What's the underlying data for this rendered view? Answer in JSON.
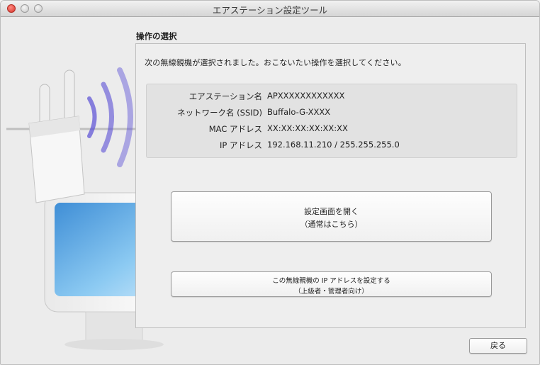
{
  "window": {
    "title": "エアステーション設定ツール"
  },
  "section": {
    "title": "操作の選択"
  },
  "instruction": "次の無線親機が選択されました。おこないたい操作を選択してください。",
  "device_info": [
    {
      "label": "エアステーション名",
      "value": "APXXXXXXXXXXXX"
    },
    {
      "label": "ネットワーク名 (SSID)",
      "value": "Buffalo-G-XXXX"
    },
    {
      "label": "MAC アドレス",
      "value": "XX:XX:XX:XX:XX:XX"
    },
    {
      "label": "IP アドレス",
      "value": "192.168.11.210 / 255.255.255.0"
    }
  ],
  "buttons": {
    "open_settings": {
      "line1": "設定画面を開く",
      "line2": "（通常はこちら）"
    },
    "set_ip": {
      "line1": "この無線親機の IP アドレスを設定する",
      "line2": "（上級者・管理者向け）"
    },
    "back": "戻る"
  },
  "colors": {
    "wave": "#5a4fd6",
    "screen": "#6cb6ea",
    "close": "#d8342c"
  }
}
